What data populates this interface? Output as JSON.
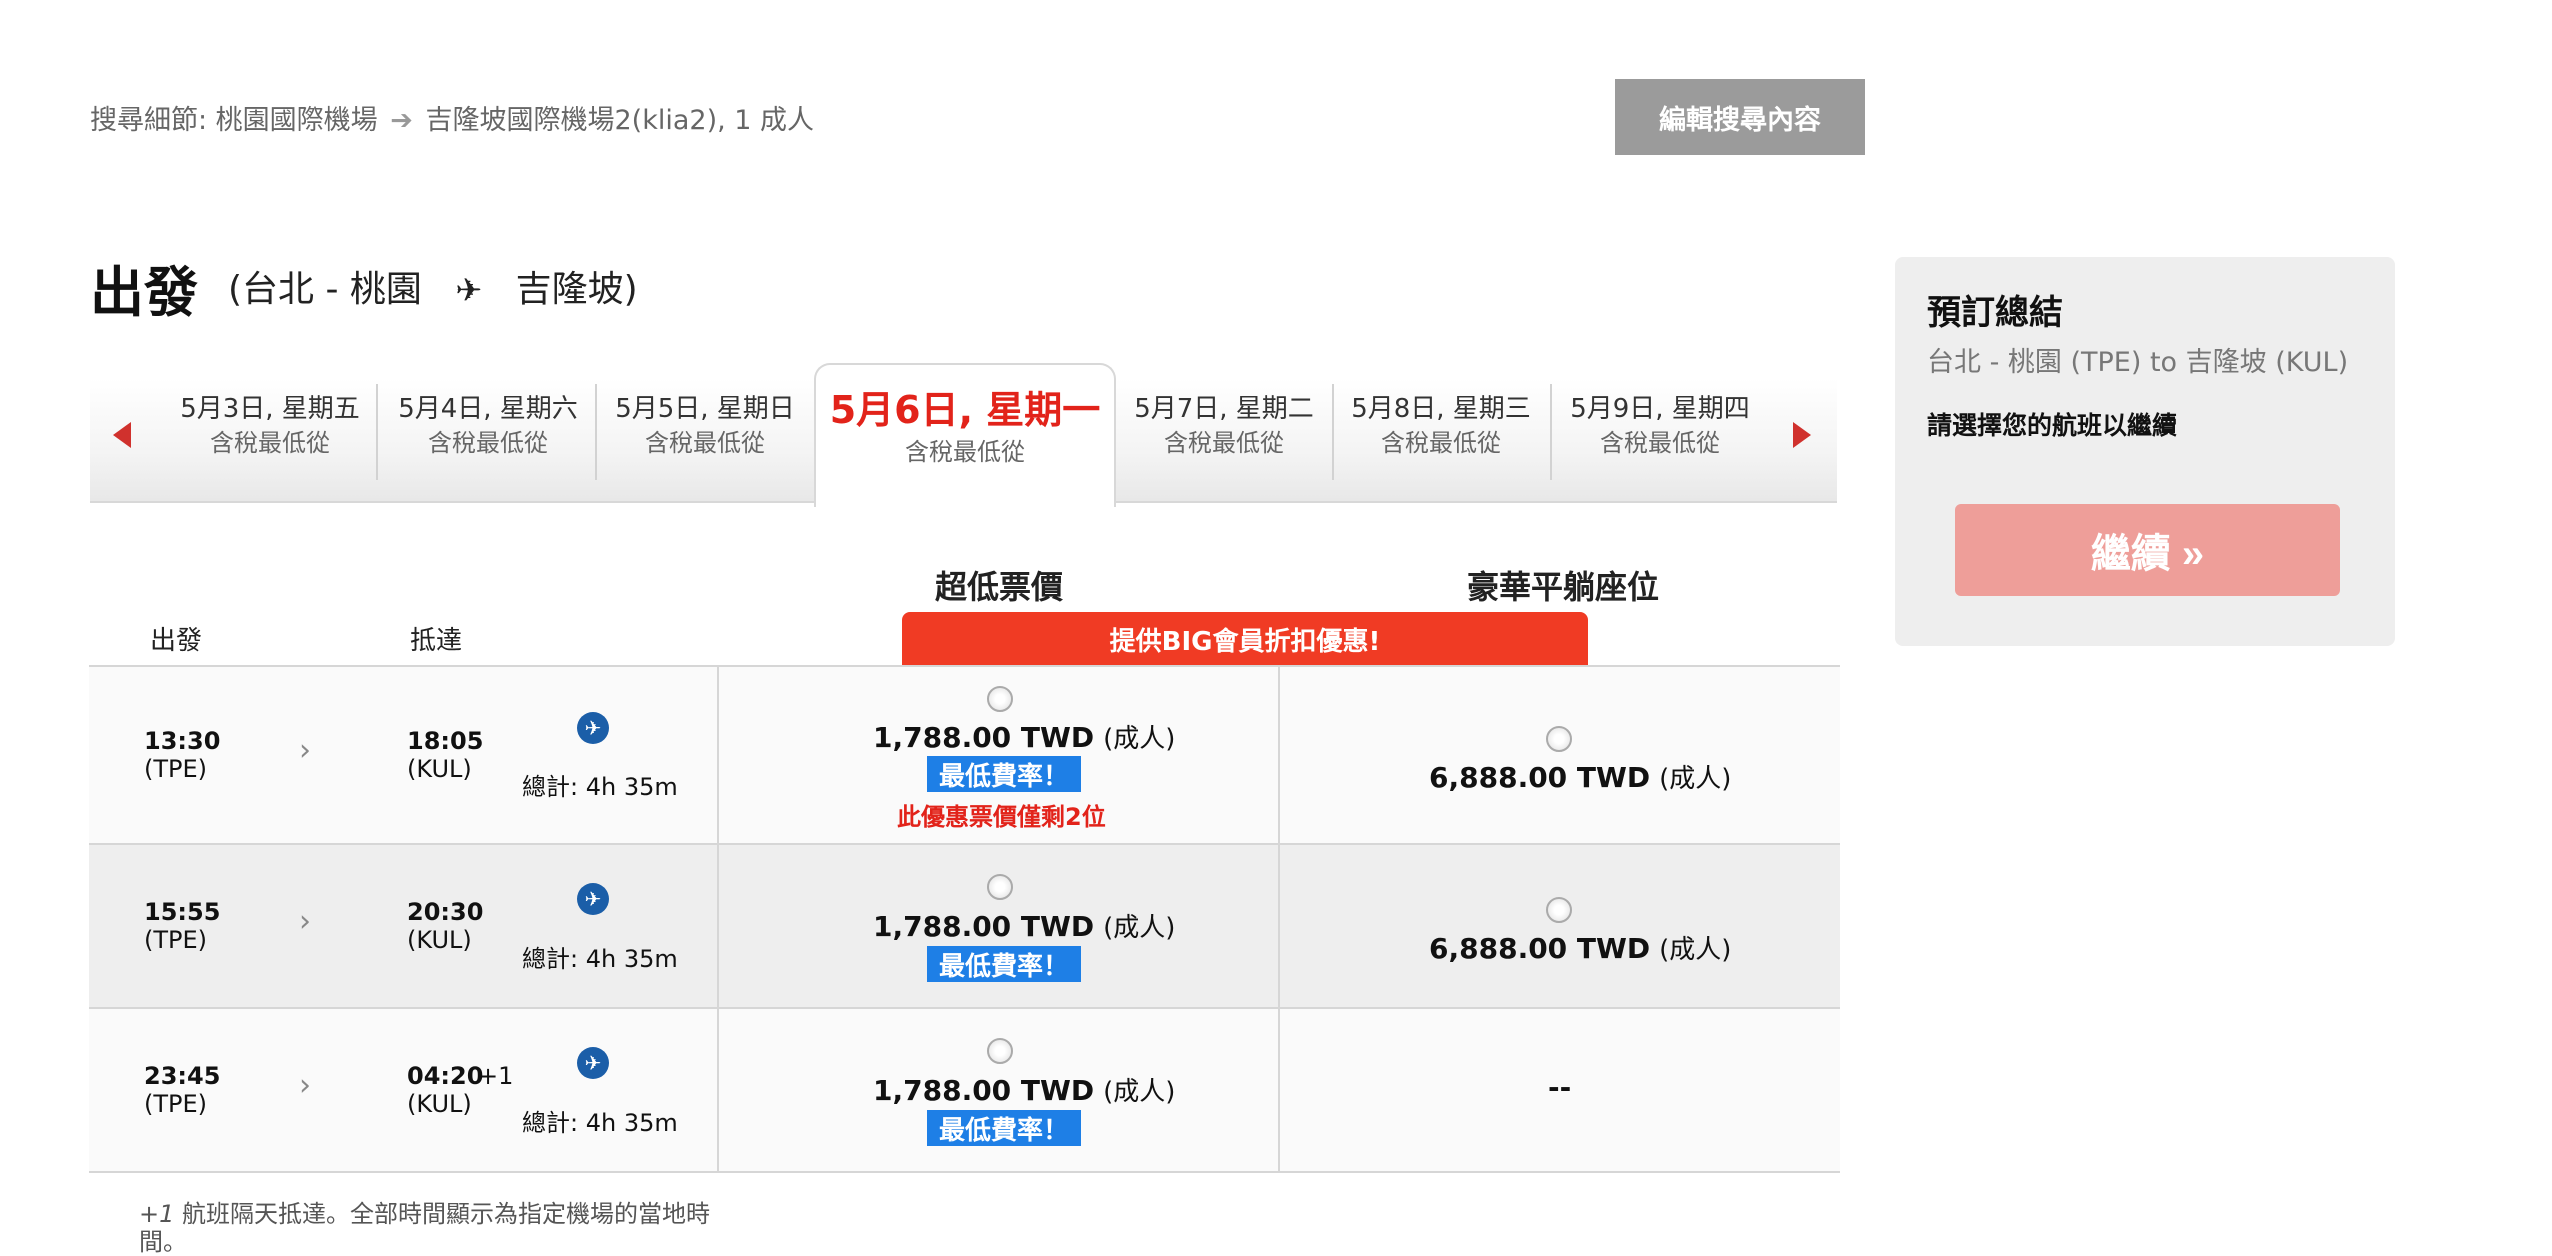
{
  "search": {
    "prefix": "搜尋細節: 桃園國際機場",
    "destination": "吉隆坡國際機場2(klia2), 1 成人",
    "edit_button": "編輯搜尋內容"
  },
  "departure": {
    "title": "出發",
    "route_from": "(台北 - 桃園",
    "route_to": "吉隆坡)"
  },
  "dates": [
    {
      "date": "5月3日, 星期五",
      "sub": "含稅最低從"
    },
    {
      "date": "5月4日, 星期六",
      "sub": "含稅最低從"
    },
    {
      "date": "5月5日, 星期日",
      "sub": "含稅最低從"
    },
    {
      "date": "5月6日, 星期一",
      "sub": "含稅最低從",
      "active": true
    },
    {
      "date": "5月7日, 星期二",
      "sub": "含稅最低從"
    },
    {
      "date": "5月8日, 星期三",
      "sub": "含稅最低從"
    },
    {
      "date": "5月9日, 星期四",
      "sub": "含稅最低從"
    }
  ],
  "columns": {
    "depart": "出發",
    "arrive": "抵達",
    "fare_low": "超低票價",
    "fare_premium": "豪華平躺座位",
    "promo": "提供BIG會員折扣優惠!"
  },
  "flights": [
    {
      "dep_time": "13:30",
      "dep_code": "(TPE)",
      "arr_time": "18:05",
      "arr_code": "(KUL)",
      "next_day": "",
      "duration": "總計: 4h 35m",
      "low_price": "1,788.00 TWD",
      "low_unit": "(成人)",
      "low_badge": "最低費率！",
      "low_note": "此優惠票價僅剩2位",
      "premium_price": "6,888.00 TWD",
      "premium_unit": "(成人)"
    },
    {
      "dep_time": "15:55",
      "dep_code": "(TPE)",
      "arr_time": "20:30",
      "arr_code": "(KUL)",
      "next_day": "",
      "duration": "總計: 4h 35m",
      "low_price": "1,788.00 TWD",
      "low_unit": "(成人)",
      "low_badge": "最低費率！",
      "premium_price": "6,888.00 TWD",
      "premium_unit": "(成人)"
    },
    {
      "dep_time": "23:45",
      "dep_code": "(TPE)",
      "arr_time": "04:20",
      "arr_code": "(KUL)",
      "next_day": "+1",
      "duration": "總計: 4h 35m",
      "low_price": "1,788.00 TWD",
      "low_unit": "(成人)",
      "low_badge": "最低費率！",
      "premium_none": "--"
    }
  ],
  "footnote": {
    "mark": "+1",
    "text": " 航班隔天抵達。全部時間顯示為指定機場的當地時間。"
  },
  "summary": {
    "title": "預訂總結",
    "route": "台北 - 桃園 (TPE) to 吉隆坡 (KUL)",
    "hint": "請選擇您的航班以繼續",
    "continue": "繼續 »"
  },
  "colors": {
    "accent": "#e2231a",
    "promo": "#f03b24",
    "badge": "#1e7fe6",
    "airline": "#1b5ea8"
  }
}
